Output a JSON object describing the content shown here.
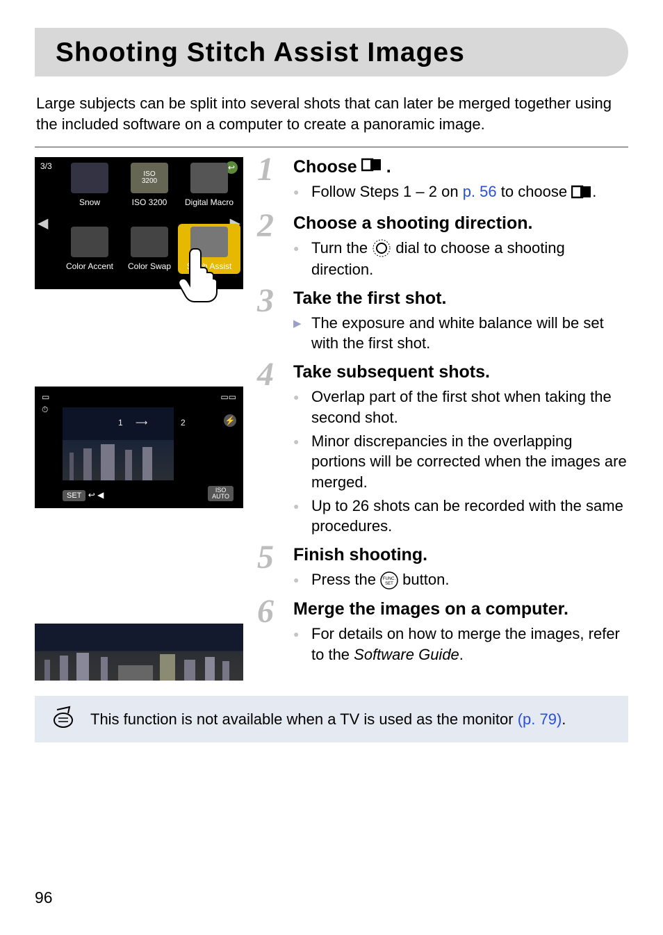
{
  "title": "Shooting Stitch Assist Images",
  "intro": "Large subjects can be split into several shots that can later be merged together using the included software on a computer to create a panoramic image.",
  "screenshot1": {
    "page_indicator": "3/3",
    "cells": [
      {
        "label": "Snow"
      },
      {
        "label": "ISO 3200",
        "badge": "ISO\n3200"
      },
      {
        "label": "Digital Macro"
      },
      {
        "label": "Color Accent"
      },
      {
        "label": "Color Swap"
      },
      {
        "label": "Stitch Assist"
      }
    ]
  },
  "screenshot2": {
    "left_chip": "SET",
    "right_chip": "ISO\nAUTO",
    "n1": "1",
    "n2": "2"
  },
  "steps": [
    {
      "num": "1",
      "head_pre": "Choose",
      "head_post": ".",
      "items": [
        {
          "type": "plain",
          "pre": "Follow Steps 1 – 2 on ",
          "link": "p. 56",
          "post": " to choose ",
          "trailing_icon": true,
          "tail": "."
        }
      ]
    },
    {
      "num": "2",
      "head": "Choose a shooting direction.",
      "items": [
        {
          "type": "plain",
          "pre": "Turn the ",
          "dial": true,
          "post": " dial to choose a shooting direction."
        }
      ]
    },
    {
      "num": "3",
      "head": "Take the first shot.",
      "items": [
        {
          "type": "arrow",
          "text": "The exposure and white balance will be set with the first shot."
        }
      ]
    },
    {
      "num": "4",
      "head": "Take subsequent shots.",
      "items": [
        {
          "type": "plain",
          "text": "Overlap part of the first shot when taking the second shot."
        },
        {
          "type": "plain",
          "text": "Minor discrepancies in the overlapping portions will be corrected when the images are merged."
        },
        {
          "type": "plain",
          "text": "Up to 26 shots can be recorded with the same procedures."
        }
      ]
    },
    {
      "num": "5",
      "head": "Finish shooting.",
      "items": [
        {
          "type": "plain",
          "pre": "Press the ",
          "func": true,
          "post": " button."
        }
      ]
    },
    {
      "num": "6",
      "head": "Merge the images on a computer.",
      "items": [
        {
          "type": "plain",
          "pre": "For details on how to merge the images, refer to the ",
          "italic": "Software Guide",
          "post": "."
        }
      ]
    }
  ],
  "note": {
    "pre": "This function is not available when a TV is used as the monitor ",
    "link": "(p. 79)",
    "post": "."
  },
  "page_number": "96"
}
